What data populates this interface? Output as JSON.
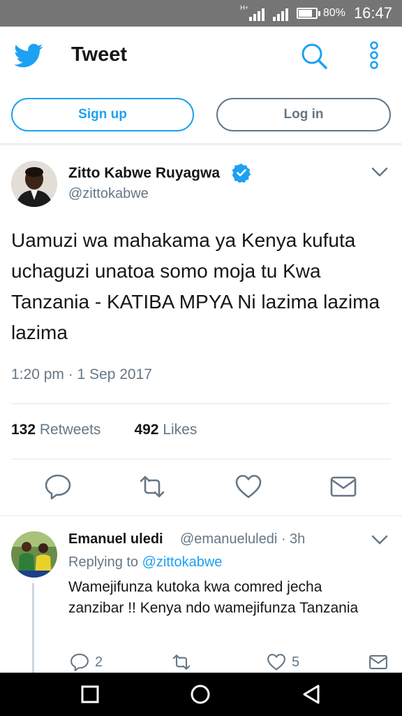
{
  "status_bar": {
    "network_label": "H+",
    "battery": "80%",
    "time": "16:47"
  },
  "header": {
    "title": "Tweet",
    "icons": [
      "twitter-bird-icon",
      "search-icon",
      "more-vertical-icon"
    ]
  },
  "auth": {
    "signup_label": "Sign up",
    "login_label": "Log in"
  },
  "tweet": {
    "author_name": "Zitto Kabwe Ruyagwa",
    "author_handle": "@zittokabwe",
    "text": "Uamuzi wa mahakama ya Kenya kufuta uchaguzi unatoa somo moja tu Kwa Tanzania - KATIBA MPYA Ni lazima lazima lazima",
    "timestamp": "1:20 pm · 1 Sep 2017",
    "retweets_count": "132",
    "retweets_label": "Retweets",
    "likes_count": "492",
    "likes_label": "Likes"
  },
  "reply": {
    "author_name": "Emanuel uledi",
    "author_handle_time": "@emanueluledi · 3h",
    "replying_prefix": "Replying to",
    "replying_to": "@zittokabwe",
    "text": "Wamejifunza kutoka kwa comred jecha zanzibar !! Kenya ndo wamejifunza Tanzania",
    "reply_count": "2",
    "like_count": "5"
  },
  "colors": {
    "accent": "#1da1f2",
    "secondary_text": "#657786",
    "status_bar": "#757575"
  }
}
